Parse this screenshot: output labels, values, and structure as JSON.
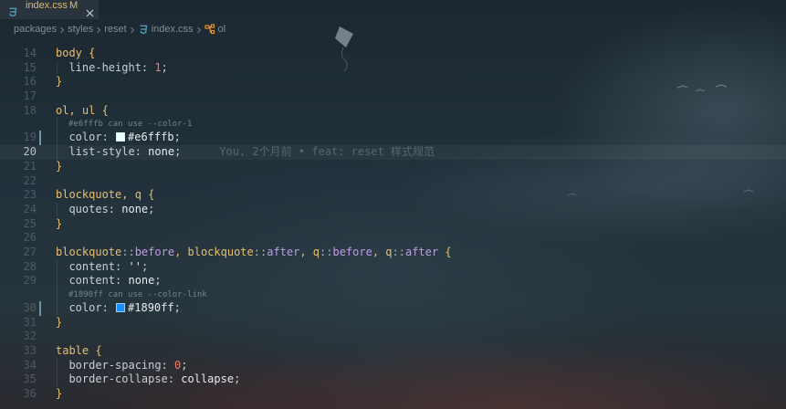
{
  "tab": {
    "label": "index.css",
    "status": "M",
    "icon": "css-file-icon",
    "color": "#e2b86b"
  },
  "breadcrumb": {
    "items": [
      {
        "label": "packages"
      },
      {
        "label": "styles"
      },
      {
        "label": "reset"
      },
      {
        "label": "index.css",
        "icon": "css-file-icon"
      },
      {
        "label": "ol",
        "icon": "symbol-class-icon"
      }
    ]
  },
  "editor": {
    "lines": [
      {
        "number": "14",
        "tokens": [
          {
            "text": "body {",
            "color": "#e6bf6f"
          }
        ]
      },
      {
        "number": "15",
        "tokens": [
          {
            "text": "  line-height: ",
            "color": "#c8cfd6"
          },
          {
            "text": "1",
            "color": "#f07c6c"
          },
          {
            "text": ";",
            "color": "#c8cfd6"
          }
        ]
      },
      {
        "number": "16",
        "tokens": [
          {
            "text": "}",
            "color": "#e6bf6f"
          }
        ]
      },
      {
        "number": "17",
        "tokens": []
      },
      {
        "number": "18",
        "tokens": [
          {
            "text": "ol, ul {",
            "color": "#e6bf6f"
          }
        ]
      },
      {
        "lens": "#e6fffb can use --color-1"
      },
      {
        "number": "19",
        "modified": true,
        "tokens": [
          {
            "text": "  color: ",
            "color": "#c8cfd6"
          },
          {
            "swatch": "#e6fffb"
          },
          {
            "text": "#e6fffb",
            "color": "#e8ecef"
          },
          {
            "text": ";",
            "color": "#c8cfd6"
          }
        ]
      },
      {
        "number": "20",
        "current": true,
        "tokens": [
          {
            "text": "  list-style: ",
            "color": "#c8cfd6"
          },
          {
            "text": "none",
            "color": "#e8ecef"
          },
          {
            "text": ";",
            "color": "#c8cfd6"
          }
        ],
        "blame": "You, 2个月前 • feat: reset 样式规范"
      },
      {
        "number": "21",
        "tokens": [
          {
            "text": "}",
            "color": "#e6bf6f"
          }
        ]
      },
      {
        "number": "22",
        "tokens": []
      },
      {
        "number": "23",
        "tokens": [
          {
            "text": "blockquote, q {",
            "color": "#e6bf6f"
          }
        ]
      },
      {
        "number": "24",
        "tokens": [
          {
            "text": "  quotes: ",
            "color": "#c8cfd6"
          },
          {
            "text": "none",
            "color": "#e8ecef"
          },
          {
            "text": ";",
            "color": "#c8cfd6"
          }
        ]
      },
      {
        "number": "25",
        "tokens": [
          {
            "text": "}",
            "color": "#e6bf6f"
          }
        ]
      },
      {
        "number": "26",
        "tokens": []
      },
      {
        "number": "27",
        "tokens": [
          {
            "text": "blockquote",
            "color": "#e6bf6f"
          },
          {
            "text": "::",
            "color": "#9fb0bb"
          },
          {
            "text": "before",
            "color": "#c39ae8"
          },
          {
            "text": ", blockquote",
            "color": "#e6bf6f"
          },
          {
            "text": "::",
            "color": "#9fb0bb"
          },
          {
            "text": "after",
            "color": "#c39ae8"
          },
          {
            "text": ", q",
            "color": "#e6bf6f"
          },
          {
            "text": "::",
            "color": "#9fb0bb"
          },
          {
            "text": "before",
            "color": "#c39ae8"
          },
          {
            "text": ", q",
            "color": "#e6bf6f"
          },
          {
            "text": "::",
            "color": "#9fb0bb"
          },
          {
            "text": "after",
            "color": "#c39ae8"
          },
          {
            "text": " {",
            "color": "#e6bf6f"
          }
        ]
      },
      {
        "number": "28",
        "tokens": [
          {
            "text": "  content: ",
            "color": "#c8cfd6"
          },
          {
            "text": "''",
            "color": "#e8ecef"
          },
          {
            "text": ";",
            "color": "#c8cfd6"
          }
        ]
      },
      {
        "number": "29",
        "tokens": [
          {
            "text": "  content: ",
            "color": "#c8cfd6"
          },
          {
            "text": "none",
            "color": "#e8ecef"
          },
          {
            "text": ";",
            "color": "#c8cfd6"
          }
        ]
      },
      {
        "lens": "#1890ff can use --color-link"
      },
      {
        "number": "30",
        "modified": true,
        "tokens": [
          {
            "text": "  color: ",
            "color": "#c8cfd6"
          },
          {
            "swatch": "#1890ff"
          },
          {
            "text": "#1890ff",
            "color": "#e8ecef"
          },
          {
            "text": ";",
            "color": "#c8cfd6"
          }
        ]
      },
      {
        "number": "31",
        "tokens": [
          {
            "text": "}",
            "color": "#e6bf6f"
          }
        ]
      },
      {
        "number": "32",
        "tokens": []
      },
      {
        "number": "33",
        "tokens": [
          {
            "text": "table {",
            "color": "#e6bf6f"
          }
        ]
      },
      {
        "number": "34",
        "tokens": [
          {
            "text": "  border-spacing: ",
            "color": "#c8cfd6"
          },
          {
            "text": "0",
            "color": "#f07c6c"
          },
          {
            "text": ";",
            "color": "#c8cfd6"
          }
        ]
      },
      {
        "number": "35",
        "tokens": [
          {
            "text": "  border-collapse: ",
            "color": "#c8cfd6"
          },
          {
            "text": "collapse",
            "color": "#e8ecef"
          },
          {
            "text": ";",
            "color": "#c8cfd6"
          }
        ]
      },
      {
        "number": "36",
        "tokens": [
          {
            "text": "}",
            "color": "#e6bf6f"
          }
        ]
      }
    ]
  }
}
